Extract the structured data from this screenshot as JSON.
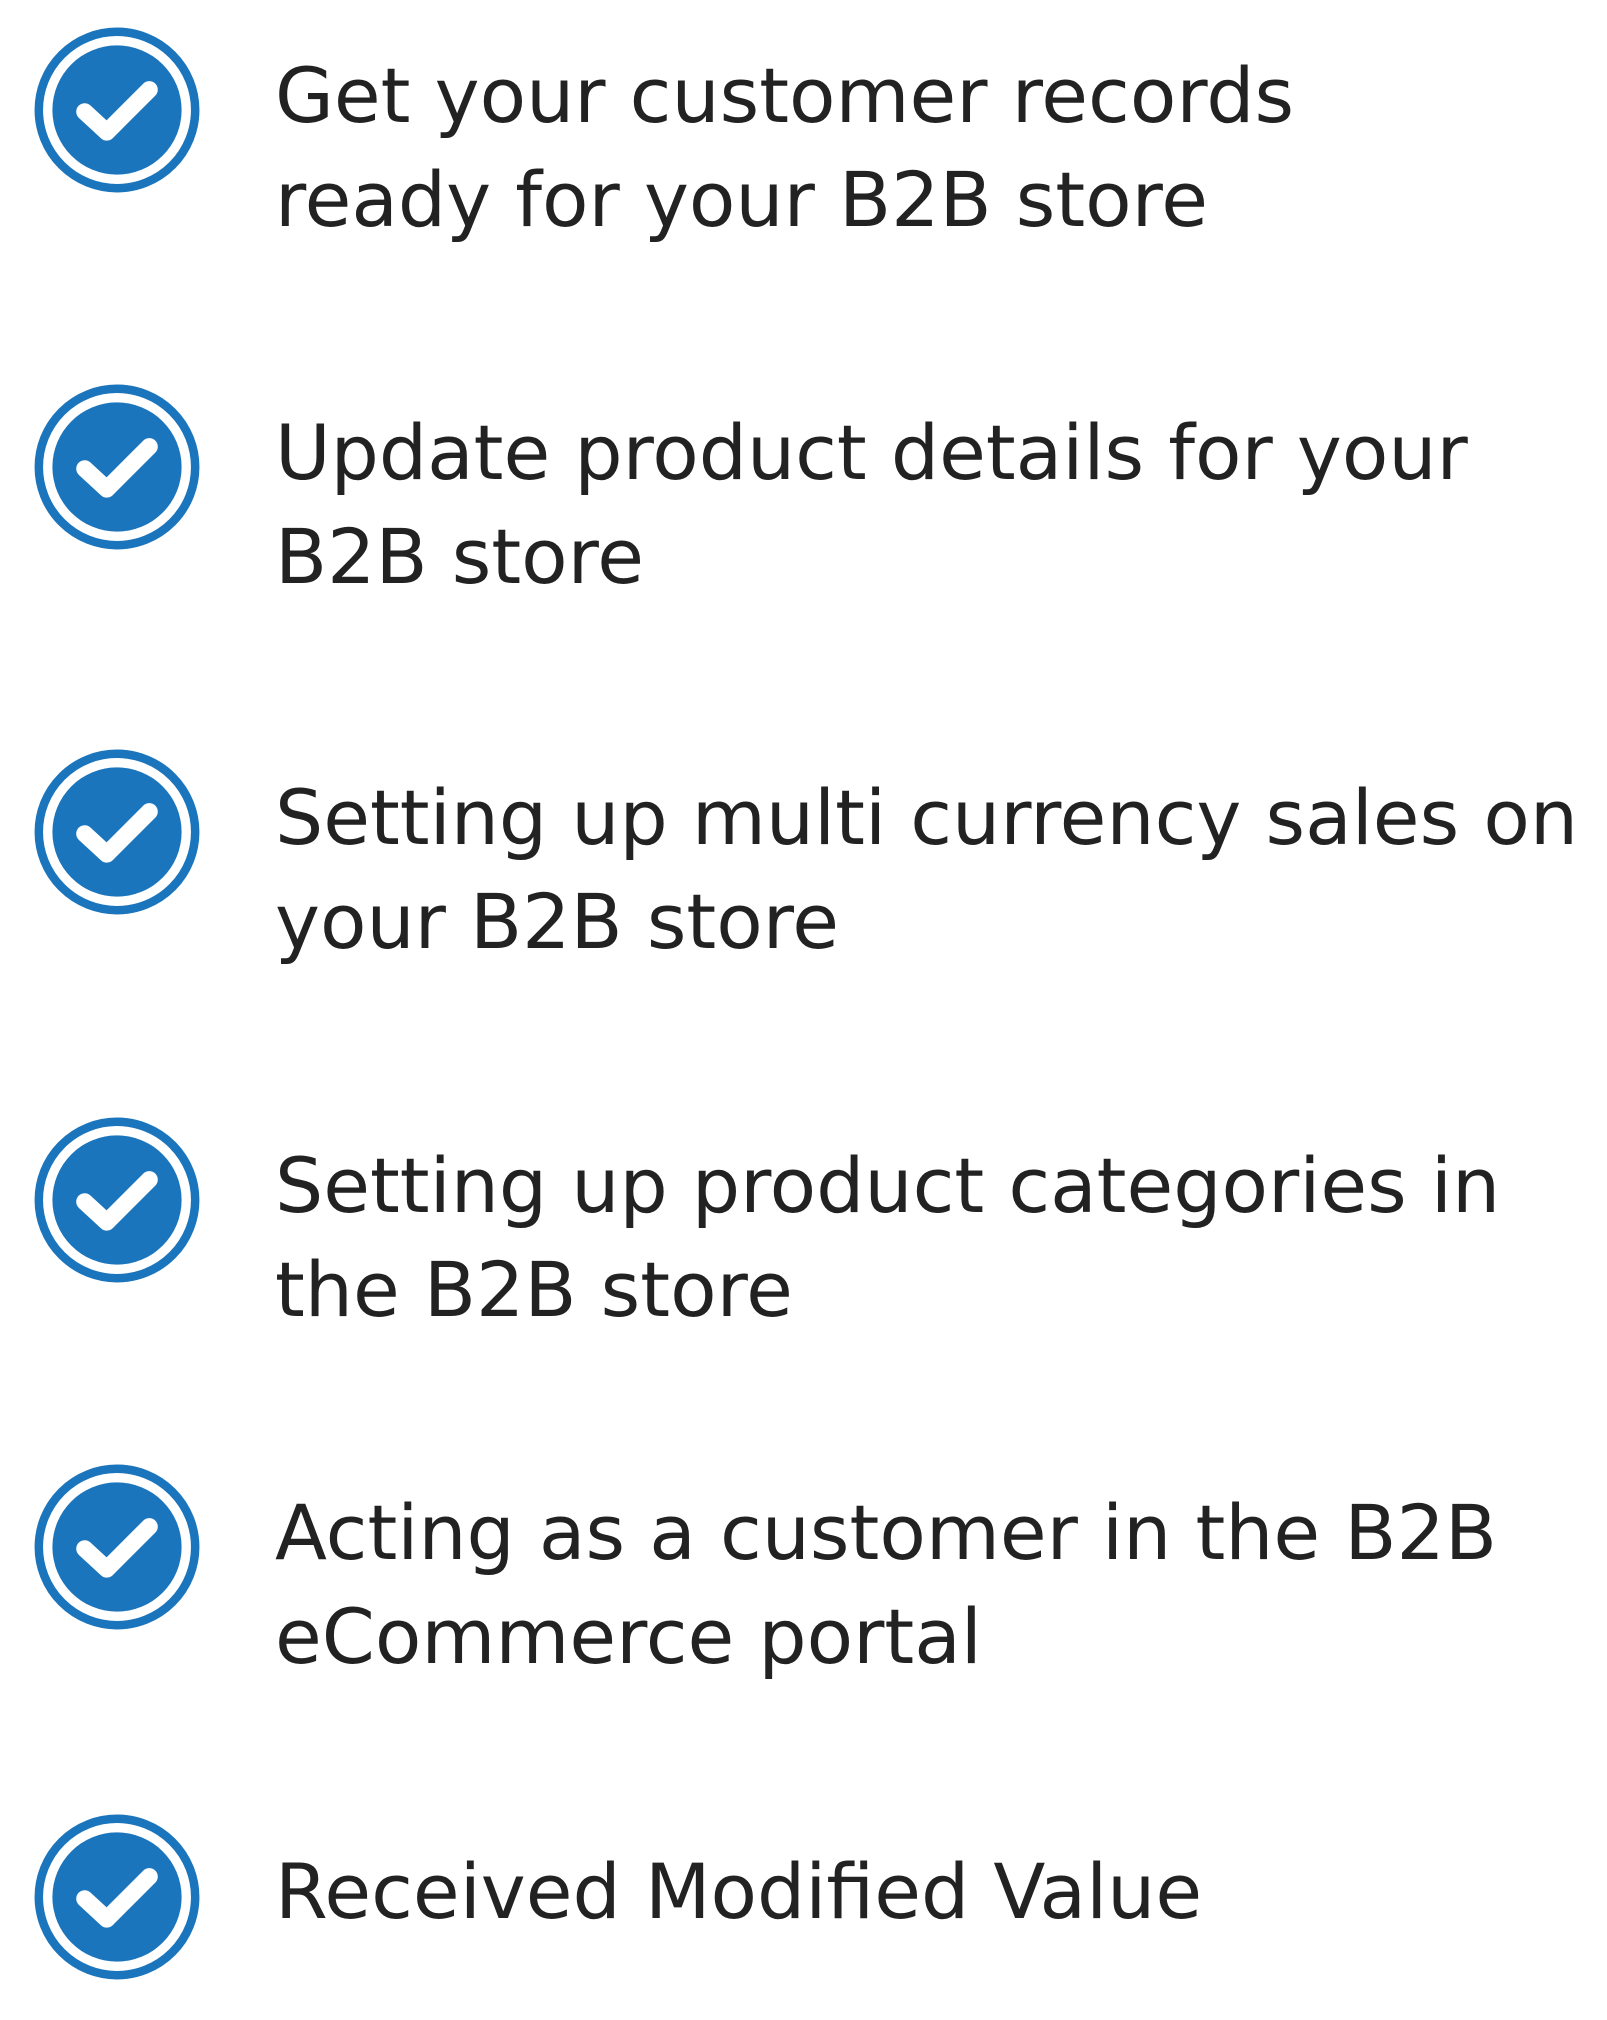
{
  "accent_color": "#1b75bc",
  "icon": "check-circle-icon",
  "items": [
    {
      "lines": [
        "Get your customer records",
        "ready for your B2B store"
      ]
    },
    {
      "lines": [
        "Update product details for your",
        "B2B store"
      ]
    },
    {
      "lines": [
        "Setting up multi currency sales on",
        "your B2B store"
      ]
    },
    {
      "lines": [
        "Setting up product categories in",
        "the B2B store"
      ]
    },
    {
      "lines": [
        "Acting as a customer in the B2B",
        "eCommerce portal"
      ]
    },
    {
      "lines": [
        "Received Modified Value"
      ]
    }
  ]
}
